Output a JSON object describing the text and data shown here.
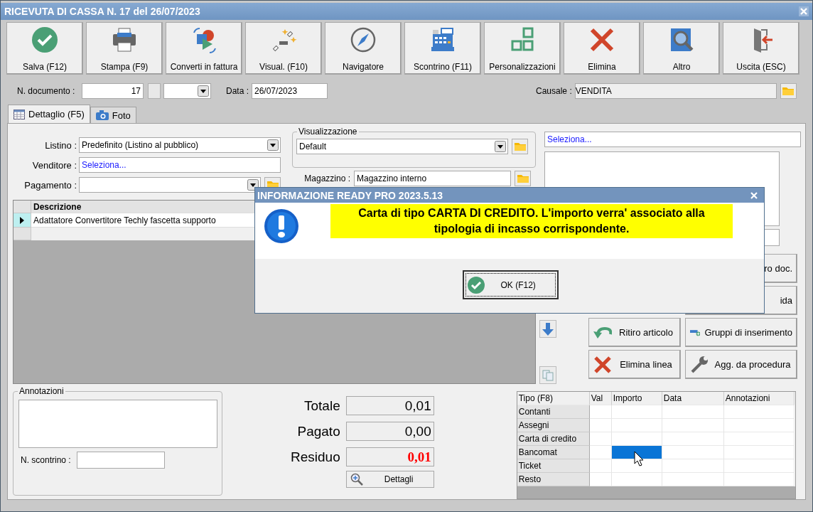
{
  "window": {
    "title": "RICEVUTA DI CASSA N. 17 del 26/07/2023"
  },
  "toolbar": [
    {
      "label": "Salva (F12)",
      "kind": "save"
    },
    {
      "label": "Stampa (F9)",
      "kind": "print"
    },
    {
      "label": "Converti in fattura",
      "kind": "convert"
    },
    {
      "label": "Visual. (F10)",
      "kind": "view"
    },
    {
      "label": "Navigatore",
      "kind": "compass"
    },
    {
      "label": "Scontrino (F11)",
      "kind": "register"
    },
    {
      "label": "Personalizzazioni",
      "kind": "squares"
    },
    {
      "label": "Elimina",
      "kind": "delete"
    },
    {
      "label": "Altro",
      "kind": "book"
    },
    {
      "label": "Uscita (ESC)",
      "kind": "exit"
    }
  ],
  "header": {
    "doc_number_label": "N. documento :",
    "doc_number": "17",
    "date_label": "Data :",
    "date": "26/07/2023",
    "causale_label": "Causale :",
    "causale": "VENDITA"
  },
  "tabs": [
    {
      "label": "Dettaglio (F5)",
      "kind": "table",
      "selected": true
    },
    {
      "label": "Foto",
      "kind": "camera",
      "selected": false
    }
  ],
  "form": {
    "listino_label": "Listino :",
    "listino": "Predefinito (Listino al pubblico)",
    "venditore_label": "Venditore :",
    "venditore": "Seleziona...",
    "pagamento_label": "Pagamento :",
    "visualizzazione_legend": "Visualizzazione",
    "visualizzazione": "Default",
    "magazzino_label": "Magazzino :",
    "magazzino": "Magazzino interno"
  },
  "grid": {
    "columns": [
      "Descrizione"
    ],
    "rows": [
      {
        "descrizione": "Adattatore Convertitore Techly fascetta supporto",
        "selected": true
      }
    ]
  },
  "right_panel": {
    "selector": "Seleziona...",
    "buttons": [
      {
        "label": "ro doc.",
        "kind": "cut"
      },
      {
        "label": "ida",
        "kind": "cut"
      },
      {
        "label": "Ritiro articolo",
        "kind": "return"
      },
      {
        "label": "Gruppi di inserimento",
        "kind": "group"
      },
      {
        "label": "Elimina linea",
        "kind": "delete"
      },
      {
        "label": "Agg. da procedura",
        "kind": "wrench"
      }
    ]
  },
  "annotazioni": {
    "legend": "Annotazioni",
    "scontrino_label": "N. scontrino :"
  },
  "totals": [
    {
      "label": "Totale",
      "value": "0,01",
      "highlight": false
    },
    {
      "label": "Pagato",
      "value": "0,00",
      "highlight": false
    },
    {
      "label": "Residuo",
      "value": "0,01",
      "highlight": true
    }
  ],
  "details_button": "Dettagli",
  "payments": {
    "columns": [
      "Tipo (F8)",
      "Val",
      "Importo",
      "Data",
      "Annotazioni"
    ],
    "rows": [
      {
        "tipo": "Contanti",
        "selected": false
      },
      {
        "tipo": "Assegni",
        "selected": false
      },
      {
        "tipo": "Carta di credito",
        "selected": false
      },
      {
        "tipo": "Bancomat",
        "selected": true
      },
      {
        "tipo": "Ticket",
        "selected": false
      },
      {
        "tipo": "Resto",
        "selected": false
      }
    ]
  },
  "dialog": {
    "title": "INFORMAZIONE READY PRO 2023.5.13",
    "message": "Carta di tipo CARTA DI CREDITO. L'importo verra' associato alla tipologia di incasso corrispondente.",
    "ok": "OK (F12)"
  }
}
